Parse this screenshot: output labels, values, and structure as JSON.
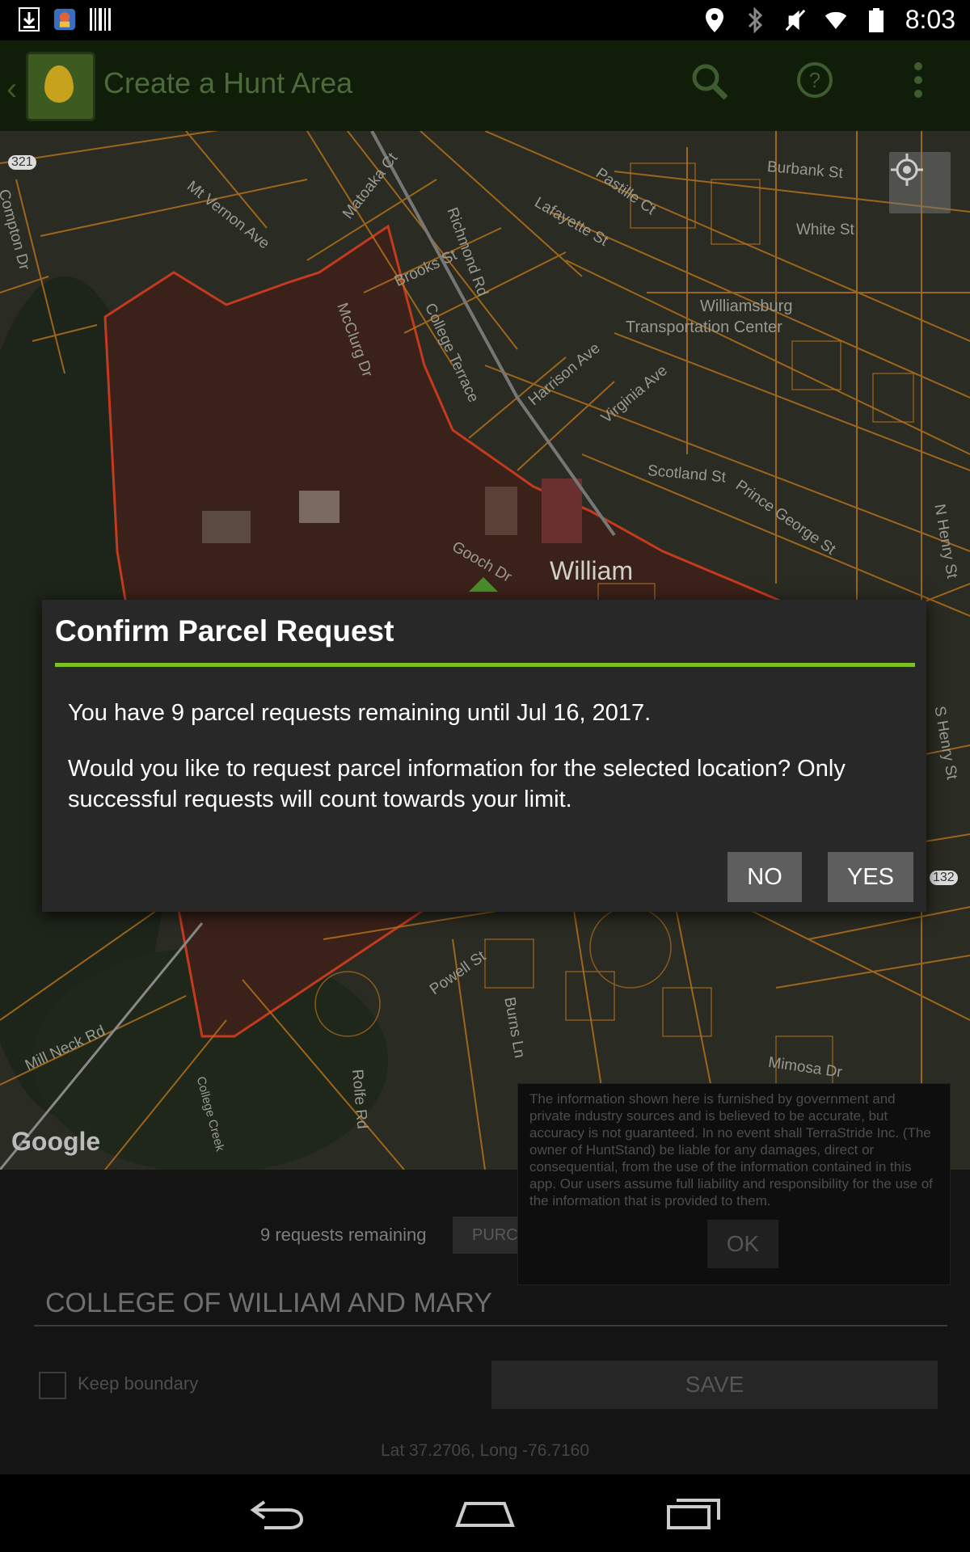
{
  "status_bar": {
    "time": "8:03",
    "left_icons": [
      "download-icon",
      "app-notification-icon",
      "barcode-icon"
    ],
    "right_icons": [
      "location-icon",
      "bluetooth-icon",
      "mute-icon",
      "wifi-icon",
      "battery-icon"
    ]
  },
  "app_bar": {
    "title": "Create a Hunt Area",
    "actions": [
      "search-icon",
      "help-icon",
      "overflow-menu-icon"
    ]
  },
  "map": {
    "labels": {
      "compton": "Compton Dr",
      "mt_vernon": "Mt Vernon Ave",
      "matoaka": "Matoaka Ct",
      "richmond": "Richmond Rd",
      "lafayette": "Lafayette St",
      "pastille": "Pastille Ct",
      "burbank": "Burbank St",
      "white": "White St",
      "brooks": "Brooks St",
      "mcclurg": "McClurg Dr",
      "college_terrace": "College Terrace",
      "williamsburg": "Williamsburg",
      "transportation": "Transportation Center",
      "harrison": "Harrison Ave",
      "virginia": "Virginia Ave",
      "scotland": "Scotland St",
      "prince_george": "Prince George St",
      "n_henry": "N Henry St",
      "s_henry": "S Henry St",
      "gooch": "Gooch Dr",
      "william": "William",
      "powell": "Powell St",
      "burns": "Burns Ln",
      "rolfe": "Rolfe Rd",
      "mill_neck": "Mill Neck Rd",
      "college_creek": "College Creek",
      "mimosa": "Mimosa Dr",
      "route_321": "321",
      "route_132": "132"
    },
    "google_logo": "Google",
    "locate_icon": "my-location-icon"
  },
  "bottom_panel": {
    "requests_remaining": "9 requests remaining",
    "purchase_label": "PURCHASE UNLIMITED",
    "area_name": "COLLEGE OF WILLIAM AND MARY",
    "keep_boundary_label": "Keep boundary",
    "keep_boundary_checked": false,
    "save_label": "SAVE",
    "coordinates": "Lat 37.2706, Long -76.7160"
  },
  "disclaimer": {
    "text": "The information shown here is furnished by government and private industry sources and is believed to be accurate, but accuracy is not guaranteed. In no event shall TerraStride Inc. (The owner of HuntStand) be liable for any damages, direct or consequential, from the use of the information contained in this app. Our users assume full liability and responsibility for the use of the information that is provided to them.",
    "ok_label": "OK"
  },
  "dialog": {
    "title": "Confirm Parcel Request",
    "message_1": "You have 9 parcel requests remaining until Jul 16, 2017.",
    "message_2": "Would you like to request parcel information for the selected location? Only successful requests will count towards your limit.",
    "no_label": "NO",
    "yes_label": "YES",
    "accent_color": "#7fbf22"
  },
  "nav_bar": {
    "buttons": [
      "back-icon",
      "home-icon",
      "recent-apps-icon"
    ]
  }
}
